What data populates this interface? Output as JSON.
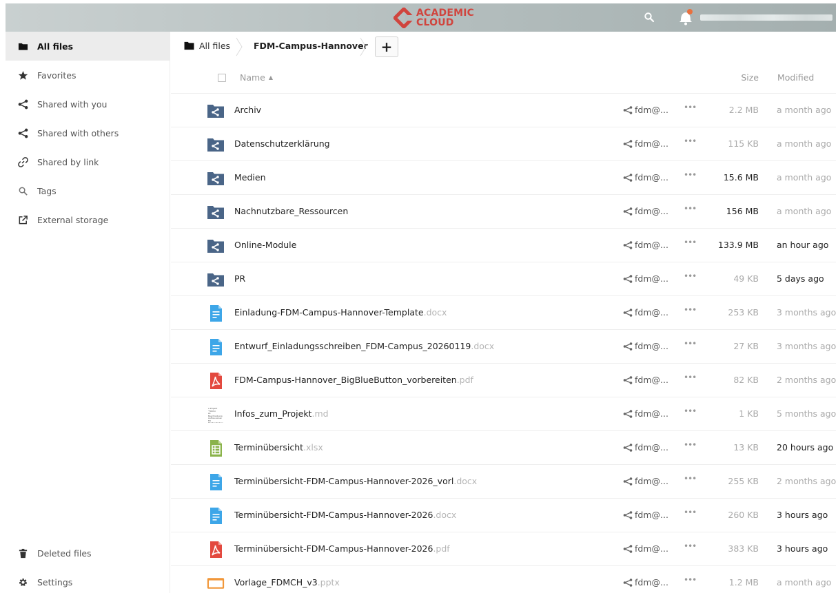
{
  "header": {
    "logo_line1": "ACADEMIC",
    "logo_line2": "CLOUD",
    "brand_color": "#d0453e",
    "icons": [
      "search-icon",
      "bell-icon"
    ]
  },
  "sidebar": {
    "items": [
      {
        "label": "All files",
        "icon": "folder-icon"
      },
      {
        "label": "Favorites",
        "icon": "star-icon"
      },
      {
        "label": "Shared with you",
        "icon": "share-icon"
      },
      {
        "label": "Shared with others",
        "icon": "share-icon"
      },
      {
        "label": "Shared by link",
        "icon": "link-icon"
      },
      {
        "label": "Tags",
        "icon": "tag-search-icon"
      },
      {
        "label": "External storage",
        "icon": "external-link-icon"
      }
    ],
    "bottom": [
      {
        "label": "Deleted files",
        "icon": "trash-icon"
      },
      {
        "label": "Settings",
        "icon": "gear-icon"
      }
    ]
  },
  "breadcrumb": {
    "home_label": "All files",
    "current": "FDM-Campus-Hannover",
    "add_label": "+"
  },
  "table": {
    "col_name": "Name",
    "sort_arrow": "▲",
    "col_size": "Size",
    "col_modified": "Modified",
    "rows": [
      {
        "name": "Archiv",
        "ext": "",
        "type": "shared-folder",
        "share": "fdm@...",
        "more": "•••",
        "size": "2.2 MB",
        "modified": "a month ago",
        "size_dark": false,
        "mod_dark": false
      },
      {
        "name": "Datenschutzerklärung",
        "ext": "",
        "type": "shared-folder",
        "share": "fdm@...",
        "more": "•••",
        "size": "115 KB",
        "modified": "a month ago",
        "size_dark": false,
        "mod_dark": false
      },
      {
        "name": "Medien",
        "ext": "",
        "type": "shared-folder",
        "share": "fdm@...",
        "more": "•••",
        "size": "15.6 MB",
        "modified": "a month ago",
        "size_dark": true,
        "mod_dark": false
      },
      {
        "name": "Nachnutzbare_Ressourcen",
        "ext": "",
        "type": "shared-folder",
        "share": "fdm@...",
        "more": "•••",
        "size": "156 MB",
        "modified": "a month ago",
        "size_dark": true,
        "mod_dark": false
      },
      {
        "name": "Online-Module",
        "ext": "",
        "type": "shared-folder",
        "share": "fdm@...",
        "more": "•••",
        "size": "133.9 MB",
        "modified": "an hour ago",
        "size_dark": true,
        "mod_dark": true
      },
      {
        "name": "PR",
        "ext": "",
        "type": "shared-folder",
        "share": "fdm@...",
        "more": "•••",
        "size": "49 KB",
        "modified": "5 days ago",
        "size_dark": false,
        "mod_dark": true
      },
      {
        "name": "Einladung-FDM-Campus-Hannover-Template",
        "ext": ".docx",
        "type": "doc",
        "share": "fdm@...",
        "more": "•••",
        "size": "253 KB",
        "modified": "3 months ago",
        "size_dark": false,
        "mod_dark": false
      },
      {
        "name": "Entwurf_Einladungsschreiben_FDM-Campus_20260119",
        "ext": ".docx",
        "type": "doc",
        "share": "fdm@...",
        "more": "•••",
        "size": "27 KB",
        "modified": "3 months ago",
        "size_dark": false,
        "mod_dark": false
      },
      {
        "name": "FDM-Campus-Hannover_BigBlueButton_vorbereiten",
        "ext": ".pdf",
        "type": "pdf",
        "share": "fdm@...",
        "more": "•••",
        "size": "82 KB",
        "modified": "2 months ago",
        "size_dark": false,
        "mod_dark": false
      },
      {
        "name": "Infos_zum_Projekt",
        "ext": ".md",
        "type": "md",
        "share": "fdm@...",
        "more": "•••",
        "size": "1 KB",
        "modified": "5 months ago",
        "size_dark": false,
        "mod_dark": false
      },
      {
        "name": "Terminübersicht",
        "ext": ".xlsx",
        "type": "xlsx",
        "share": "fdm@...",
        "more": "•••",
        "size": "13 KB",
        "modified": "20 hours ago",
        "size_dark": false,
        "mod_dark": true
      },
      {
        "name": "Terminübersicht-FDM-Campus-Hannover-2026_vorl",
        "ext": ".docx",
        "type": "doc",
        "share": "fdm@...",
        "more": "•••",
        "size": "255 KB",
        "modified": "2 months ago",
        "size_dark": false,
        "mod_dark": false
      },
      {
        "name": "Terminübersicht-FDM-Campus-Hannover-2026",
        "ext": ".docx",
        "type": "doc",
        "share": "fdm@...",
        "more": "•••",
        "size": "260 KB",
        "modified": "3 hours ago",
        "size_dark": false,
        "mod_dark": true
      },
      {
        "name": "Terminübersicht-FDM-Campus-Hannover-2026",
        "ext": ".pdf",
        "type": "pdf",
        "share": "fdm@...",
        "more": "•••",
        "size": "383 KB",
        "modified": "3 hours ago",
        "size_dark": false,
        "mod_dark": true
      },
      {
        "name": "Vorlage_FDMCH_v3",
        "ext": ".pptx",
        "type": "pptx",
        "share": "fdm@...",
        "more": "•••",
        "size": "1.2 MB",
        "modified": "a month ago",
        "size_dark": false,
        "mod_dark": false
      }
    ]
  }
}
